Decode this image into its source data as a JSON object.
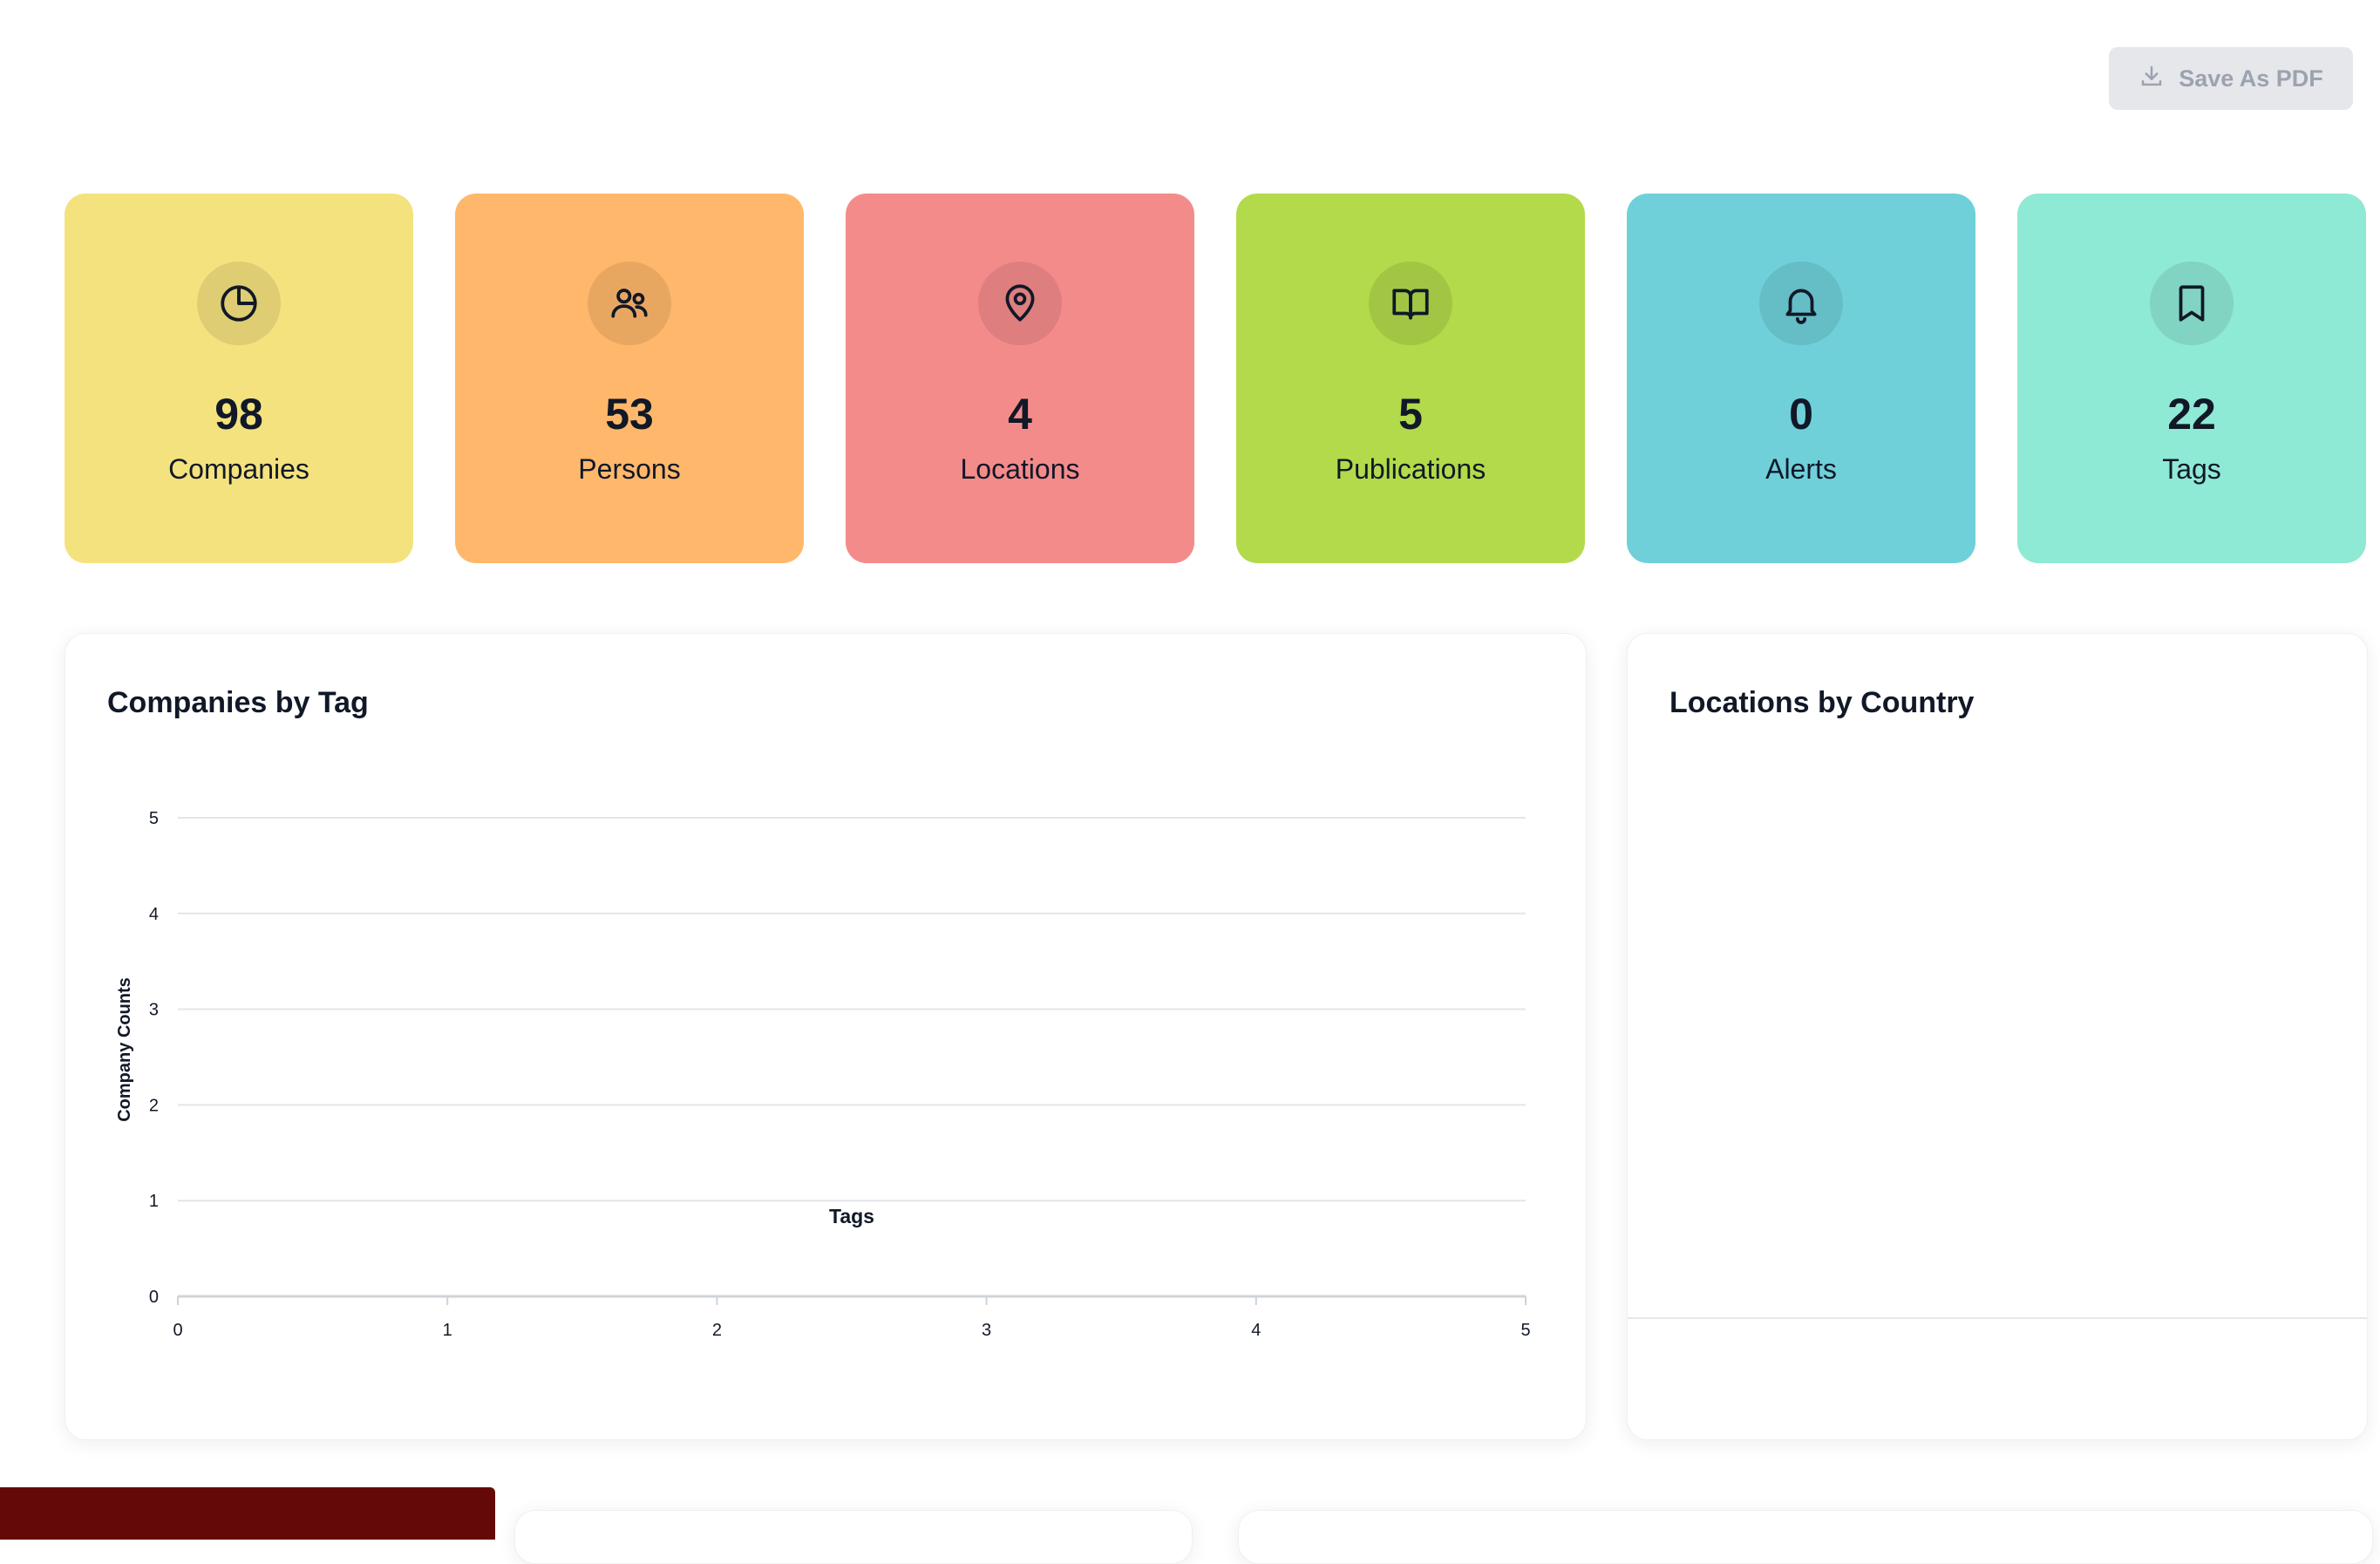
{
  "header": {
    "save_pdf_label": "Save As PDF",
    "save_pdf_icon": "download-icon"
  },
  "stats": [
    {
      "value": "98",
      "label": "Companies",
      "icon": "pie-chart-icon",
      "color": "#f4e27e"
    },
    {
      "value": "53",
      "label": "Persons",
      "icon": "users-icon",
      "color": "#ffb86b"
    },
    {
      "value": "4",
      "label": "Locations",
      "icon": "map-pin-icon",
      "color": "#f48b8b"
    },
    {
      "value": "5",
      "label": "Publications",
      "icon": "book-open-icon",
      "color": "#b3da4a"
    },
    {
      "value": "0",
      "label": "Alerts",
      "icon": "bell-icon",
      "color": "#6fd0da"
    },
    {
      "value": "22",
      "label": "Tags",
      "icon": "bookmark-icon",
      "color": "#8ee9d5"
    }
  ],
  "panels": {
    "companies_by_tag": {
      "title": "Companies by Tag"
    },
    "locations_by_country": {
      "title": "Locations by Country"
    }
  },
  "chart_data": {
    "type": "bar",
    "title": "Companies by Tag",
    "xlabel": "Tags",
    "ylabel": "Company Counts",
    "categories": [],
    "values": [],
    "xlim": [
      0,
      5
    ],
    "ylim": [
      0,
      5
    ],
    "x_ticks": [
      "0",
      "1",
      "2",
      "3",
      "4",
      "5"
    ],
    "y_ticks": [
      "0",
      "1",
      "2",
      "3",
      "4",
      "5"
    ],
    "grid": true
  },
  "toast": {
    "color": "#650808"
  }
}
